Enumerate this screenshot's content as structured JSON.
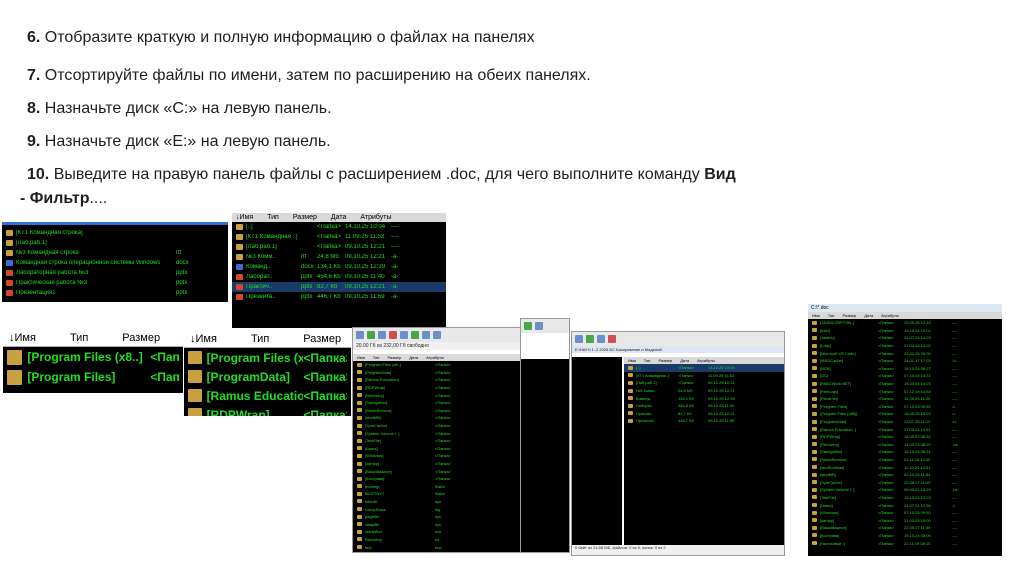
{
  "instructions": [
    {
      "num": "6.",
      "text": " Отобразите краткую и полную информацию о файлах на панелях"
    },
    {
      "num": "7.",
      "text": " Отсортируйте файлы по имени, затем по расширению на обеих панелях."
    },
    {
      "num": "8.",
      "text": " Назначьте диск «C:» на левую панель."
    },
    {
      "num": "9.",
      "text": " Назначьте диск «E:» на левую панель."
    },
    {
      "num": "10.",
      "text": " Выведите на правую панель файлы с расширением .doc, для чего выполните команду ",
      "bold_tail": "Вид",
      "line2_bold": "- Фильтр",
      "line2_tail": "...."
    }
  ],
  "shot1": {
    "rows": [
      {
        "name": "[КТ1 Командная строка]",
        "ext": ""
      },
      {
        "name": "[Лаб.раб.1]",
        "ext": ""
      },
      {
        "name": "№3 Командная строка",
        "ext": "rtf"
      },
      {
        "name": "Командная строка операционной системы Windows",
        "ext": "docx"
      },
      {
        "name": "Лабораторная работа №3",
        "ext": "pptx"
      },
      {
        "name": "Практическая работа №3",
        "ext": "pptx"
      },
      {
        "name": "Презентация1",
        "ext": "pptx"
      }
    ]
  },
  "shot2": {
    "headers": [
      "Имя",
      "Тип",
      "Размер",
      "Дата",
      "Атрибуты"
    ],
    "rows": [
      {
        "name": "[..]",
        "type": "",
        "size": "<Папка>",
        "date": "14.10.25 10:04",
        "attr": "----"
      },
      {
        "name": "[КТ1 Командная ..]",
        "type": "",
        "size": "<Папка>",
        "date": "11.09.25 11:53",
        "attr": "----"
      },
      {
        "name": "[Лаб.раб.1]",
        "type": "",
        "size": "<Папка>",
        "date": "09.10.25 12:21",
        "attr": "----"
      },
      {
        "name": "№3 Комм..",
        "type": "rtf",
        "size": "24.8 Мб",
        "date": "09.10.25 12:21",
        "attr": "-a-"
      },
      {
        "name": "Команд..",
        "type": "docx",
        "size": "134,1 Кб",
        "date": "09.10.25 12:39",
        "attr": "-a-"
      },
      {
        "name": "Лаборат..",
        "type": "pptx",
        "size": "454,6 Кб",
        "date": "09.10.25 11:40",
        "attr": "-a-"
      },
      {
        "name": "Практич..",
        "type": "pptx",
        "size": "82,7 Кб",
        "date": "09.10.25 12:21",
        "attr": "-a-"
      },
      {
        "name": "Презента..",
        "type": "pptx",
        "size": "446,7 Кб",
        "date": "09.10.25 11:59",
        "attr": "-a-"
      }
    ]
  },
  "shot3": {
    "headers": [
      "Имя",
      "Тип",
      "Размер"
    ],
    "rows": [
      {
        "name": "[Program Files (x8..]",
        "size": "<Папка>"
      },
      {
        "name": "[Program Files]",
        "size": "<Папка>"
      }
    ]
  },
  "shot4": {
    "headers": [
      "Имя",
      "Тип",
      "Размер"
    ],
    "rows": [
      {
        "name": "[Program Files (x8..]",
        "size": "<Папка>"
      },
      {
        "name": "[ProgramData]",
        "size": "<Папка>"
      },
      {
        "name": "[Ramus Education..]",
        "size": "<Папка>"
      },
      {
        "name": "[RDPWrap]",
        "size": "<Папка>"
      }
    ]
  },
  "shot8": {
    "title": "C:\\*.doc",
    "headers": [
      "Имя",
      "Тип",
      "Размер",
      "Дата",
      "Атрибуты"
    ],
    "rows": [
      {
        "name": "[JAVASCRIPTOB..]",
        "size": "<Папка>",
        "date": "20.09.25 12:15",
        "attr": "----"
      },
      {
        "name": "[Intel]",
        "size": "<Папка>",
        "date": "19.10.24 10:01",
        "attr": "----"
      },
      {
        "name": "[Jaasvu]",
        "size": "<Папка>",
        "date": "21.07.24 14:25",
        "attr": "----"
      },
      {
        "name": "[Logs]",
        "size": "<Папка>",
        "date": "27.04.16 10:02",
        "attr": "----"
      },
      {
        "name": "[Microsoft VS Code]",
        "size": "<Папка>",
        "date": "23.02.25 09:09",
        "attr": "----"
      },
      {
        "name": "[MSOCache]",
        "size": "<Папка>",
        "date": "24.01.17 17:03",
        "attr": "-h-"
      },
      {
        "name": "[NCB]",
        "size": "<Папка>",
        "date": "19.10.24 08:27",
        "attr": "----"
      },
      {
        "name": "[OC]",
        "size": "<Папка>",
        "date": "07.10.24 14:22",
        "attr": "----"
      },
      {
        "name": "[PABCWork.NET]",
        "size": "<Папка>",
        "date": "15.03.24 14:25",
        "attr": "----"
      },
      {
        "name": "[PerfLogs]",
        "size": "<Папка>",
        "date": "07.12.19 14:54",
        "attr": "----"
      },
      {
        "name": "[Privat.txt]",
        "size": "<Папка>",
        "date": "16.09.25 11:25",
        "attr": "----"
      },
      {
        "name": "[Program Files]",
        "size": "<Папка>",
        "date": "07.10.25 09:50",
        "attr": "-r-"
      },
      {
        "name": "[Program Files (x86)]",
        "size": "<Папка>",
        "date": "18.05.25 15:22",
        "attr": "-r-"
      },
      {
        "name": "[ProgramData]",
        "size": "<Папка>",
        "date": "23.07.25 11:12",
        "attr": "-h-"
      },
      {
        "name": "[Ramus Education..]",
        "size": "<Папка>",
        "date": "27.05.24 15:51",
        "attr": "----"
      },
      {
        "name": "[RDPWrap]",
        "size": "<Папка>",
        "date": "18.05.22 08:32",
        "attr": "----"
      },
      {
        "name": "[Recovery]",
        "size": "<Папка>",
        "date": "14.09.23 08:20",
        "attr": "-hs"
      },
      {
        "name": "[Samigalbin]",
        "size": "<Папка>",
        "date": "16.10.24 08:31",
        "attr": "----"
      },
      {
        "name": "[StudaRenova]",
        "size": "<Папка>",
        "date": "01.11.24 12:40",
        "attr": "----"
      },
      {
        "name": "[studKodinas]",
        "size": "<Папка>",
        "date": "11.10.24 12:31",
        "attr": "----"
      },
      {
        "name": "[studMB]",
        "size": "<Папка>",
        "date": "02.10.25 11:54",
        "attr": "----"
      },
      {
        "name": "[SymCache]",
        "size": "<Папка>",
        "date": "22.05.17 11:49",
        "attr": "----"
      },
      {
        "name": "[System Volume I..]",
        "size": "<Папка>",
        "date": "09.09.21 15:29",
        "attr": "-hs"
      },
      {
        "name": "[TestFile]",
        "size": "<Папка>",
        "date": "19.10.24 12:03",
        "attr": "----"
      },
      {
        "name": "[Users]",
        "size": "<Папка>",
        "date": "21.07.21 12:56",
        "attr": "-r-"
      },
      {
        "name": "[Windows]",
        "size": "<Папка>",
        "date": "07.10.25 09:50",
        "attr": "----"
      },
      {
        "name": "[xampp]",
        "size": "<Папка>",
        "date": "31.03.25 15:00",
        "attr": "----"
      },
      {
        "name": "[ВашиВажное]",
        "size": "<Папка>",
        "date": "22.05.17 11:49",
        "attr": "----"
      },
      {
        "name": "[Кострава]",
        "size": "<Папка>",
        "date": "19.10.24 08:05",
        "attr": "----"
      },
      {
        "name": "[Налоговые..]",
        "size": "<Папка>",
        "date": "22.11.19 08:10",
        "attr": "----"
      }
    ]
  },
  "shot7": {
    "title": "E:\\НАУЧ 1..2 2025 БС Базирование и Мадилий",
    "footer": "0 байт из 24,58 МБ, файлов: 0 из 5, папок: 0 из 2",
    "headers": [
      "Имя",
      "Тип",
      "Размер",
      "Дата",
      "Атрибуты"
    ],
    "rows": [
      {
        "name": "[..]",
        "size": "<Папка>",
        "date": "14.10.25 10:04"
      },
      {
        "name": "[КТ1 Командная..]",
        "size": "<Папка>",
        "date": "11.09.25 11:53"
      },
      {
        "name": "[Лаб.раб.1]",
        "size": "<Папка>",
        "date": "09.10.25 12:21"
      },
      {
        "name": "№3 Комм..",
        "size": "24.8 Мб",
        "date": "09.10.25 12:21"
      },
      {
        "name": "Команд..",
        "size": "134,1 Кб",
        "date": "09.10.25 12:39"
      },
      {
        "name": "Лаборат..",
        "size": "454,6 Кб",
        "date": "09.10.25 11:40"
      },
      {
        "name": "Практич..",
        "size": "82,7 Кб",
        "date": "09.10.25 12:21"
      },
      {
        "name": "Презента..",
        "size": "446,7 Кб",
        "date": "09.10.25 11:59"
      }
    ]
  },
  "shot5": {
    "title": "20.00 Гб из 232,00 Гб свободно",
    "headers": [
      "Имя",
      "Тип",
      "Размер",
      "Дата",
      "Атрибуты"
    ],
    "rows": [
      {
        "name": "[Program Files (x8..]",
        "size": "<Папка>"
      },
      {
        "name": "[ProgramData]",
        "size": "<Папка>"
      },
      {
        "name": "[Ramus Education]",
        "size": "<Папка>"
      },
      {
        "name": "[RDPWrap]",
        "size": "<Папка>"
      },
      {
        "name": "[Recovery]",
        "size": "<Папка>"
      },
      {
        "name": "[Samigalbin]",
        "size": "<Папка>"
      },
      {
        "name": "[StudaRenova]",
        "size": "<Папка>"
      },
      {
        "name": "[studMB]",
        "size": "<Папка>"
      },
      {
        "name": "[SymCache]",
        "size": "<Папка>"
      },
      {
        "name": "[System Volume I..]",
        "size": "<Папка>"
      },
      {
        "name": "[TestFile]",
        "size": "<Папка>"
      },
      {
        "name": "[Users]",
        "size": "<Папка>"
      },
      {
        "name": "[Windows]",
        "size": "<Папка>"
      },
      {
        "name": "[xampp]",
        "size": "<Папка>"
      },
      {
        "name": "[ВашиВажное]",
        "size": "<Папка>"
      },
      {
        "name": "[Кострава]",
        "size": "<Папка>"
      },
      {
        "name": "bootmgr",
        "size": "Файл"
      },
      {
        "name": "BOOTNXT",
        "size": "Файл"
      },
      {
        "name": "hiberfil",
        "size": "sys"
      },
      {
        "name": "DumpStack",
        "size": "log"
      },
      {
        "name": "pagefile",
        "size": "sys"
      },
      {
        "name": "swapfile",
        "size": "sys"
      },
      {
        "name": "loadWind",
        "size": "exe"
      },
      {
        "name": "Recovery",
        "size": "txt"
      },
      {
        "name": "tmp",
        "size": "tmp"
      }
    ]
  }
}
